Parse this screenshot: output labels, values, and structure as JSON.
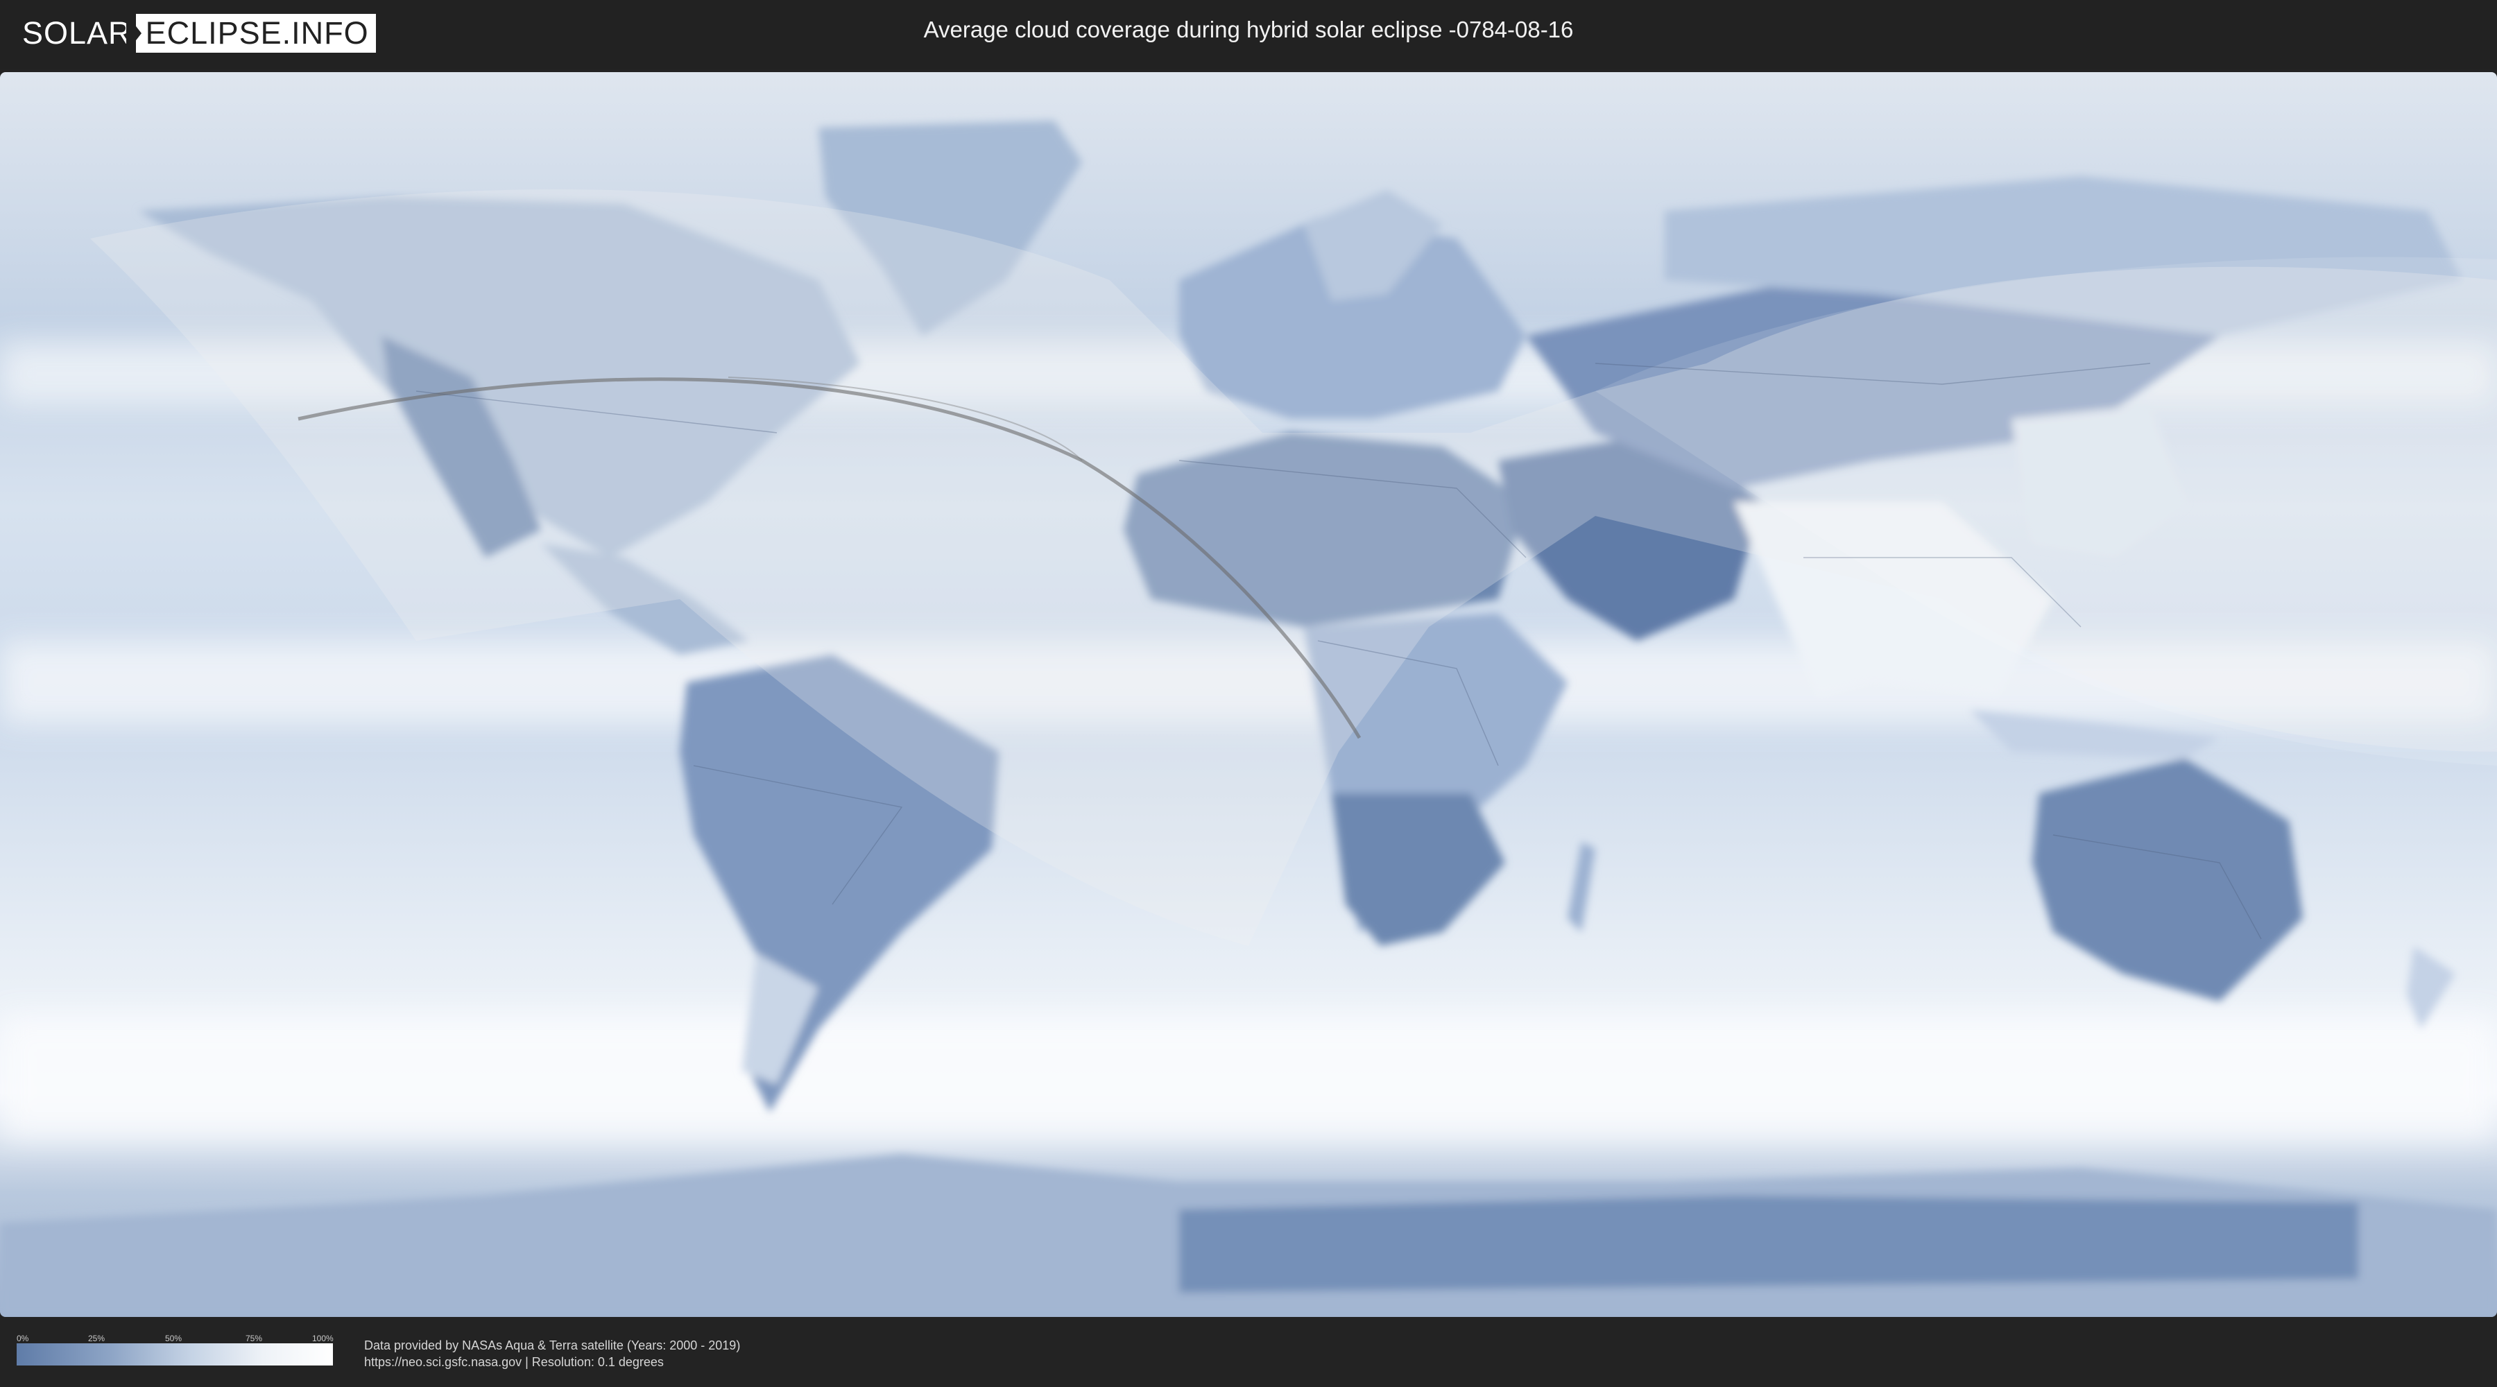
{
  "header": {
    "logo_left": "SOLAR",
    "logo_right": "ECLIPSE.INFO",
    "title": "Average cloud coverage during hybrid solar eclipse -0784-08-16"
  },
  "legend": {
    "ticks": [
      "0%",
      "25%",
      "50%",
      "75%",
      "100%"
    ],
    "gradient_colors": [
      "#5f7ca8",
      "#8ea5c6",
      "#c5d3e5",
      "#eef2f7",
      "#ffffff"
    ]
  },
  "footer": {
    "credit_line1": "Data provided by NASAs Aqua & Terra satellite (Years: 2000 - 2019)",
    "credit_line2": "https://neo.sci.gsfc.nasa.gov | Resolution: 0.1 degrees"
  },
  "colors": {
    "bar_background": "#222222",
    "ocean_cloud": "#c8d6e8",
    "dry_land": "#5f7ca8",
    "cloudy": "#ffffff"
  }
}
